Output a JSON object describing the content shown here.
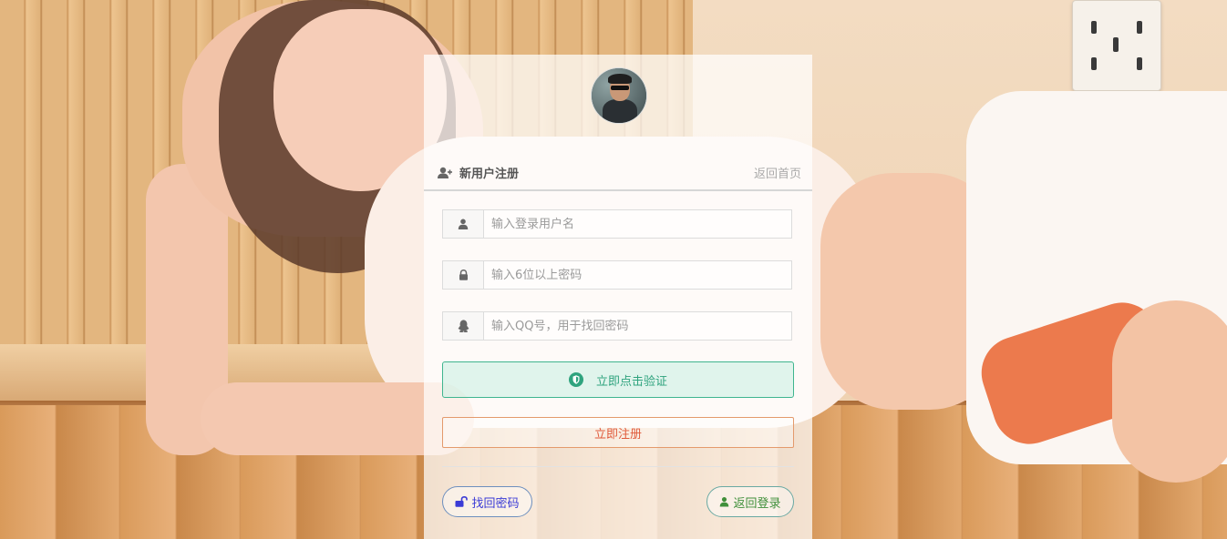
{
  "header": {
    "title": "新用户注册",
    "back_link": "返回首页"
  },
  "form": {
    "username_placeholder": "输入登录用户名",
    "password_placeholder": "输入6位以上密码",
    "qq_placeholder": "输入QQ号，用于找回密码",
    "verify_label": "立即点击验证",
    "register_label": "立即注册"
  },
  "footer": {
    "find_password": "找回密码",
    "back_login": "返回登录"
  },
  "colors": {
    "verify_green": "#2fa37e",
    "register_red": "#e05a3a",
    "find_blue": "#3b3bd6",
    "login_green": "#3f8f3a"
  },
  "icons": {
    "header": "user-plus-icon",
    "username": "user-icon",
    "password": "lock-icon",
    "qq": "qq-penguin-icon",
    "verify": "shield-icon",
    "find": "unlock-icon",
    "login": "user-icon"
  }
}
